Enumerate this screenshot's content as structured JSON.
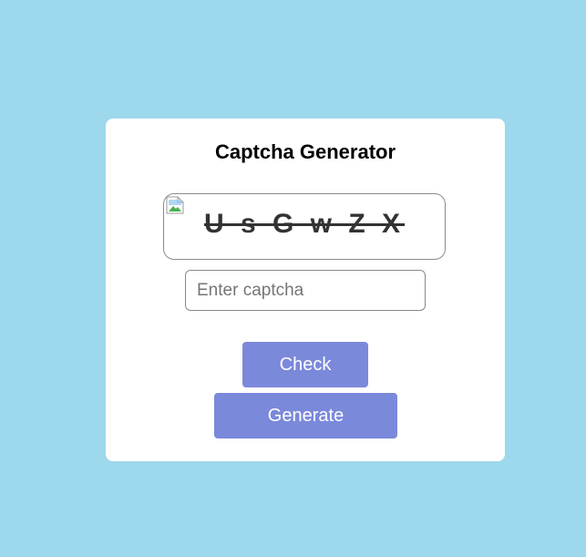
{
  "card": {
    "title": "Captcha Generator"
  },
  "captcha": {
    "text": "U s G w Z X",
    "image_icon": "broken-image-icon"
  },
  "input": {
    "value": "",
    "placeholder": "Enter captcha"
  },
  "buttons": {
    "check_label": "Check",
    "generate_label": "Generate"
  },
  "colors": {
    "background": "#9dd8ec",
    "card": "#ffffff",
    "button": "#7b89db",
    "captcha_text": "#333333"
  }
}
